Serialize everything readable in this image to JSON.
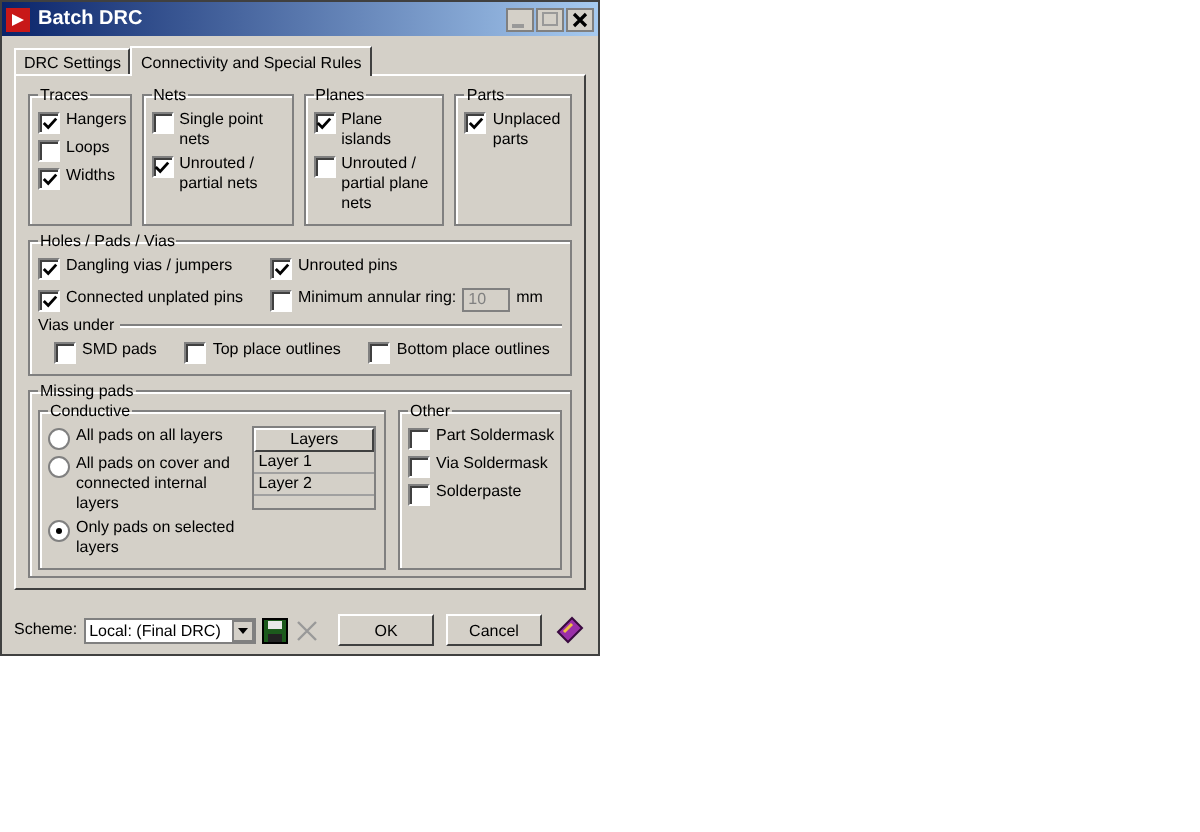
{
  "window": {
    "title": "Batch DRC"
  },
  "tabs": [
    {
      "label": "DRC Settings",
      "selected": false
    },
    {
      "label": "Connectivity and Special Rules",
      "selected": true
    }
  ],
  "top_groups": [
    {
      "title": "Traces",
      "items": [
        {
          "label": "Hangers",
          "checked": true
        },
        {
          "label": "Loops",
          "checked": false
        },
        {
          "label": "Widths",
          "checked": true
        }
      ]
    },
    {
      "title": "Nets",
      "items": [
        {
          "label": "Single point nets",
          "checked": false
        },
        {
          "label": "Unrouted / partial nets",
          "checked": true
        }
      ]
    },
    {
      "title": "Planes",
      "items": [
        {
          "label": "Plane islands",
          "checked": true
        },
        {
          "label": "Unrouted / partial plane nets",
          "checked": false
        }
      ]
    },
    {
      "title": "Parts",
      "items": [
        {
          "label": "Unplaced parts",
          "checked": true
        }
      ]
    }
  ],
  "holes": {
    "title": "Holes / Pads / Vias",
    "items": [
      {
        "kind": "check",
        "label": "Dangling vias / jumpers",
        "checked": true
      },
      {
        "kind": "check",
        "label": "Unrouted pins",
        "checked": true
      },
      {
        "kind": "check",
        "label": "Connected unplated pins",
        "checked": true
      },
      {
        "kind": "ring",
        "label": "Minimum annular ring:",
        "checked": false,
        "value": "10",
        "unit": "mm",
        "disabled": true
      }
    ],
    "vias_under": {
      "title": "Vias under",
      "items": [
        {
          "label": "SMD pads",
          "checked": false
        },
        {
          "label": "Top place outlines",
          "checked": false
        },
        {
          "label": "Bottom place outlines",
          "checked": false
        }
      ]
    }
  },
  "missing_pads": {
    "title": "Missing pads",
    "conductive": {
      "title": "Conductive",
      "options": [
        {
          "label": "All pads on all layers",
          "selected": false
        },
        {
          "label": "All pads on cover and connected internal layers",
          "selected": false
        },
        {
          "label": "Only pads on selected layers",
          "selected": true
        }
      ],
      "layers": {
        "header": "Layers",
        "rows": [
          "Layer 1",
          "Layer 2"
        ]
      }
    },
    "other": {
      "title": "Other",
      "items": [
        {
          "label": "Part Soldermask",
          "checked": false
        },
        {
          "label": "Via Soldermask",
          "checked": false
        },
        {
          "label": "Solderpaste",
          "checked": false
        }
      ]
    }
  },
  "scheme": {
    "label": "Scheme:",
    "value": "Local: (Final DRC)"
  },
  "buttons": [
    "OK",
    "Cancel"
  ]
}
